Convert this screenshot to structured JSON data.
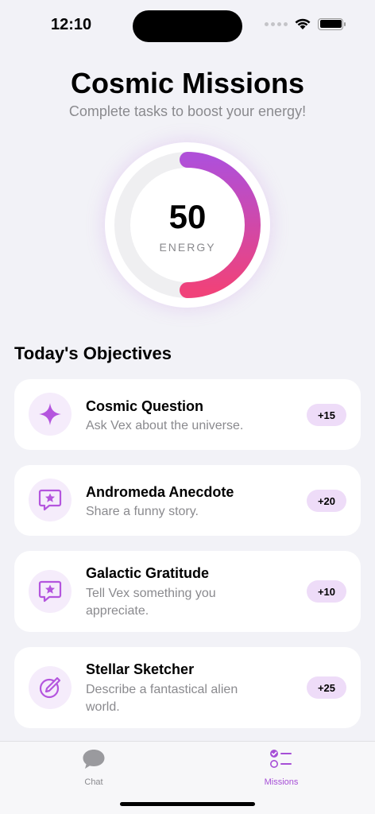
{
  "status": {
    "time": "12:10"
  },
  "header": {
    "title": "Cosmic Missions",
    "subtitle": "Complete tasks to boost your energy!"
  },
  "energy": {
    "value": "50",
    "label": "ENERGY",
    "progress": 0.5
  },
  "objectives": {
    "heading": "Today's Objectives",
    "items": [
      {
        "title": "Cosmic Question",
        "description": "Ask Vex about the universe.",
        "reward": "+15",
        "icon": "sparkle-icon"
      },
      {
        "title": "Andromeda Anecdote",
        "description": "Share a funny story.",
        "reward": "+20",
        "icon": "star-message-icon"
      },
      {
        "title": "Galactic Gratitude",
        "description": "Tell Vex something you appreciate.",
        "reward": "+10",
        "icon": "star-message-icon"
      },
      {
        "title": "Stellar Sketcher",
        "description": "Describe a fantastical alien world.",
        "reward": "+25",
        "icon": "pencil-circle-icon"
      }
    ]
  },
  "tabs": [
    {
      "label": "Chat",
      "icon": "chat-bubble-icon",
      "active": false
    },
    {
      "label": "Missions",
      "icon": "checklist-icon",
      "active": true
    }
  ],
  "colors": {
    "accent": "#a64fd6",
    "ring_start": "#b04fd8",
    "ring_end": "#f0427a",
    "badge_bg": "#eedcf8",
    "icon_bg": "#f5ecfb"
  }
}
